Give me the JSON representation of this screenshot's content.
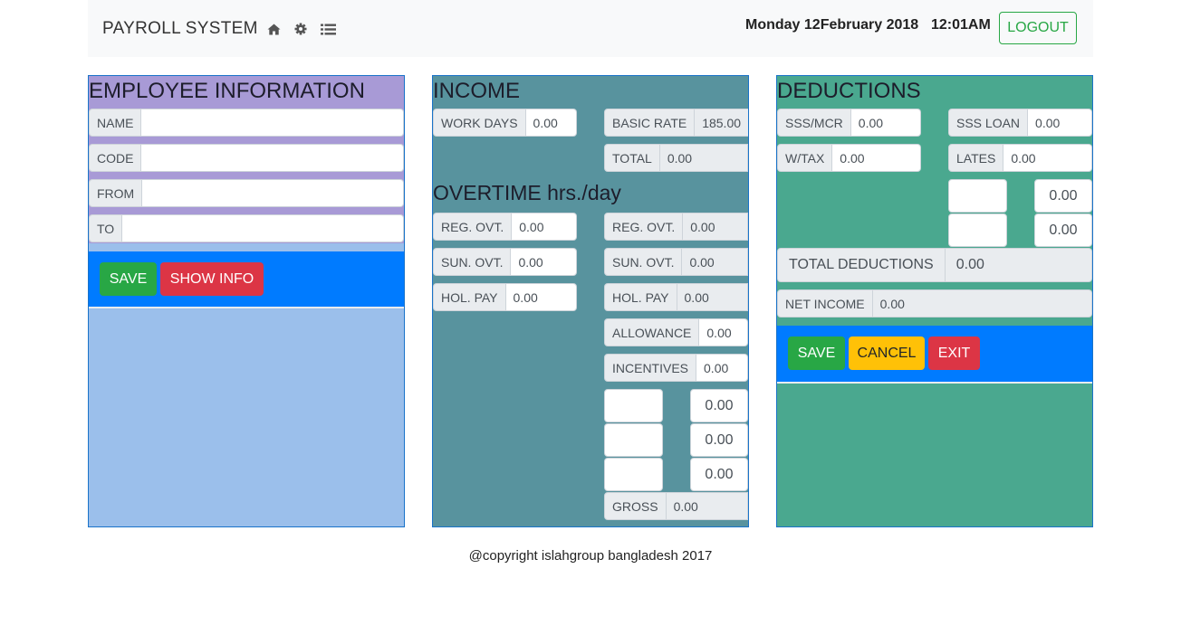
{
  "navbar": {
    "brand": "PAYROLL SYSTEM",
    "icons": [
      "home-icon",
      "gear-icon",
      "list-icon"
    ],
    "date": "Monday 12February 2018",
    "time": "12:01AM",
    "logout_label": "LOGOUT"
  },
  "colors": {
    "employee_bg": "#9bbfeb",
    "employee_title_bg": "#a89ad6",
    "income_bg": "#58939e",
    "deductions_bg": "#4aa88f",
    "primary": "#007bff",
    "success": "#28a745",
    "danger": "#dc3545",
    "warning": "#ffc107"
  },
  "employee": {
    "title": "EMPLOYEE INFORMATION",
    "name_label": "NAME",
    "name_value": "",
    "code_label": "CODE",
    "code_value": "",
    "from_label": "FROM",
    "from_value": "",
    "to_label": "TO",
    "to_value": "",
    "save_label": "SAVE",
    "show_info_label": "SHOW INFO"
  },
  "income": {
    "title": "INCOME",
    "work_days_label": "WORK DAYS",
    "work_days_value": "0.00",
    "basic_rate_label": "BASIC RATE",
    "basic_rate_value": "185.00",
    "total_label": "TOTAL",
    "total_value": "0.00",
    "overtime_title": "OVERTIME hrs./day",
    "reg_ovt_label": "REG. OVT.",
    "reg_ovt_hours": "0.00",
    "reg_ovt_amount": "0.00",
    "sun_ovt_label": "SUN. OVT.",
    "sun_ovt_hours": "0.00",
    "sun_ovt_amount": "0.00",
    "hol_pay_label": "HOL. PAY",
    "hol_pay_hours": "0.00",
    "hol_pay_amount": "0.00",
    "allowance_label": "ALLOWANCE",
    "allowance_value": "0.00",
    "incentives_label": "INCENTIVES",
    "incentives_value": "0.00",
    "extra_amounts": [
      "0.00",
      "0.00",
      "0.00"
    ],
    "gross_label": "GROSS",
    "gross_value": "0.00"
  },
  "deductions": {
    "title": "DEDUCTIONS",
    "sss_mcr_label": "SSS/MCR",
    "sss_mcr_value": "0.00",
    "sss_loan_label": "SSS LOAN",
    "sss_loan_value": "0.00",
    "wtax_label": "W/TAX",
    "wtax_value": "0.00",
    "lates_label": "LATES",
    "lates_value": "0.00",
    "extra_amounts": [
      "0.00",
      "0.00"
    ],
    "total_label": "TOTAL DEDUCTIONS",
    "total_value": "0.00",
    "net_income_label": "NET INCOME",
    "net_income_value": "0.00",
    "save_label": "SAVE",
    "cancel_label": "CANCEL",
    "exit_label": "EXIT"
  },
  "footer": {
    "text": "@copyright islahgroup bangladesh 2017"
  }
}
